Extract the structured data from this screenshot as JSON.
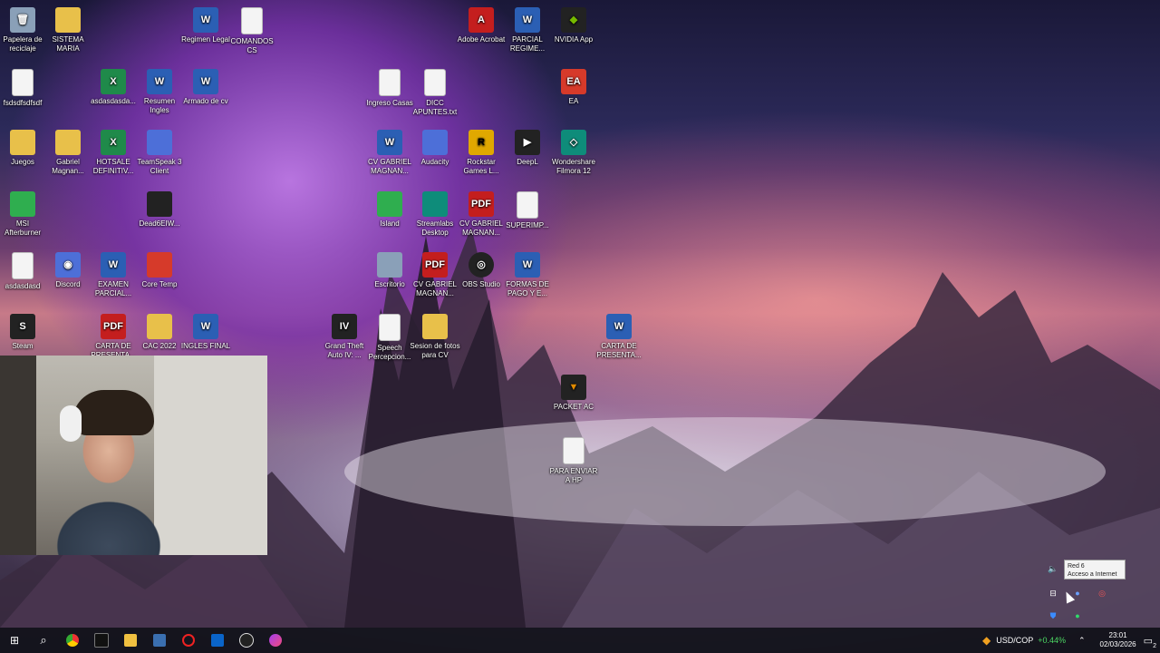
{
  "desktop_icons": [
    {
      "label": "Papelera de reciclaje",
      "kind": "recycle"
    },
    {
      "label": "SISTEMA MARIA",
      "kind": "folder"
    },
    {
      "label": "Regimen Legal",
      "kind": "word"
    },
    {
      "label": "COMANDOS CS",
      "kind": "doc"
    },
    {
      "label": "Adobe Acrobat",
      "kind": "pdf"
    },
    {
      "label": "PARCIAL REGIME...",
      "kind": "word"
    },
    {
      "label": "NVIDIA App",
      "kind": "nvidia"
    },
    {
      "label": "fsdsdfsdfsdf",
      "kind": "doc"
    },
    {
      "label": "asdasdasda...",
      "kind": "excel"
    },
    {
      "label": "Resumen Ingles",
      "kind": "word"
    },
    {
      "label": "Armado de cv",
      "kind": "word"
    },
    {
      "label": "Ingreso Casas",
      "kind": "doc"
    },
    {
      "label": "DICC APUNTES.txt",
      "kind": "doc"
    },
    {
      "label": "EA",
      "kind": "ea"
    },
    {
      "label": "Juegos",
      "kind": "folder"
    },
    {
      "label": "Gabriel Magnan...",
      "kind": "folder"
    },
    {
      "label": "HOTSALE DEFINITIV...",
      "kind": "excel"
    },
    {
      "label": "TeamSpeak 3 Client",
      "kind": "teamspeak"
    },
    {
      "label": "CV GABRIEL MAGNAN...",
      "kind": "word"
    },
    {
      "label": "Audacity",
      "kind": "audacity"
    },
    {
      "label": "Rockstar Games L...",
      "kind": "rockstar"
    },
    {
      "label": "DeepL",
      "kind": "deepl"
    },
    {
      "label": "Wondershare Filmora 12",
      "kind": "filmora"
    },
    {
      "label": "MSI Afterburner",
      "kind": "msi"
    },
    {
      "label": "Dead6EIW...",
      "kind": "dark"
    },
    {
      "label": "Island",
      "kind": "island"
    },
    {
      "label": "Streamlabs Desktop",
      "kind": "streamlabs"
    },
    {
      "label": "CV GABRIEL MAGNAN...",
      "kind": "pdf"
    },
    {
      "label": "SUPERIMP...",
      "kind": "doc"
    },
    {
      "label": "asdasdasd",
      "kind": "doc"
    },
    {
      "label": "Discord",
      "kind": "discord"
    },
    {
      "label": "EXAMEN PARCIAL...",
      "kind": "word"
    },
    {
      "label": "Core Temp",
      "kind": "coretemp"
    },
    {
      "label": "Escritorio",
      "kind": "gray"
    },
    {
      "label": "CV GABRIEL MAGNAN...",
      "kind": "pdf"
    },
    {
      "label": "OBS Studio",
      "kind": "obs"
    },
    {
      "label": "FORMAS DE PAGO Y E...",
      "kind": "word"
    },
    {
      "label": "Steam",
      "kind": "steam"
    },
    {
      "label": "CARTA DE PRESENTA...",
      "kind": "pdf"
    },
    {
      "label": "CAC 2022",
      "kind": "folder"
    },
    {
      "label": "INGLES FINAL",
      "kind": "word"
    },
    {
      "label": "Grand Theft Auto IV: ...",
      "kind": "gta"
    },
    {
      "label": "Speech Percepcion...",
      "kind": "doc"
    },
    {
      "label": "Sesion de fotos para CV",
      "kind": "folder"
    },
    {
      "label": "CARTA DE PRESENTA...",
      "kind": "word"
    },
    {
      "label": "PACKET AC",
      "kind": "packet"
    },
    {
      "label": "PARA ENVIAR A HP",
      "kind": "doc"
    }
  ],
  "tray_tooltip": {
    "line1": "Red 6",
    "line2": "Acceso a Internet"
  },
  "taskbar": {
    "ticker_symbol": "USD/COP",
    "ticker_change": "+0.44%",
    "time": "23:01",
    "date": "02/03/2026",
    "notification_count": "2"
  },
  "colors": {
    "taskbar": "#14141c",
    "ticker_positive": "#4cd964",
    "accent": "#2b5fb4"
  }
}
